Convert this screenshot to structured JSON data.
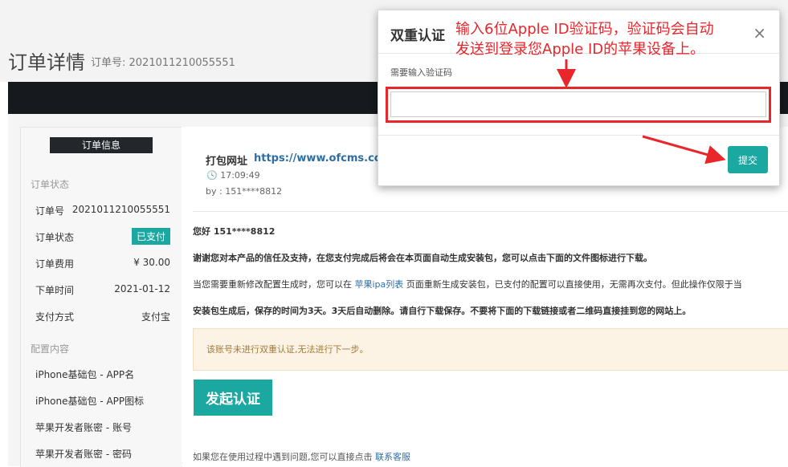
{
  "page": {
    "title": "订单详情",
    "order_no_label": "订单号: 2021011210055551"
  },
  "sidebar": {
    "title": "订单信息",
    "section_status": "订单状态",
    "rows": [
      {
        "key": "订单号",
        "value": "2021011210055551"
      },
      {
        "key": "订单状态",
        "value": "已支付"
      },
      {
        "key": "订单费用",
        "value": "¥ 30.00"
      },
      {
        "key": "下单时间",
        "value": "2021-01-12"
      },
      {
        "key": "支付方式",
        "value": "支付宝"
      }
    ],
    "section_config": "配置内容",
    "config_items": [
      "iPhone基础包 - APP名",
      "iPhone基础包 - APP图标",
      "苹果开发者账密 - 账号",
      "苹果开发者账密 - 密码"
    ]
  },
  "main": {
    "pack_url_label": "打包网址",
    "pack_url": "https://www.ofcms.co",
    "time": "17:09:49",
    "by": "by : 151****8812",
    "greeting": "您好 151****8812",
    "para1": "谢谢您对本产品的信任及支持，在您支付完成后将会在本页面自动生成安装包，您可以点击下面的文件图标进行下载。",
    "para2_a": "当您需要重新修改配置生成时，您可以在 ",
    "para2_link": "苹果ipa列表",
    "para2_b": " 页面重新生成安装包，已支付的配置可以直接使用，无需再次支付。但此操作仅限于当",
    "para3": "安装包生成后，保存的时间为3天。3天后自动删除。请自行下载保存。不要将下面的下载链接或者二维码直接挂到您的网站上。",
    "warning": "该账号未进行双重认证,无法进行下一步。",
    "start_button": "发起认证",
    "help_text": "如果您在使用过程中遇到问题,您可以直接点击 ",
    "help_link": "联系客服"
  },
  "modal": {
    "title": "双重认证",
    "close": "×",
    "input_label": "需要输入验证码",
    "input_value": "",
    "submit": "提交"
  },
  "annotation": {
    "line1": "输入6位Apple ID验证码，验证码会自动",
    "line2": "发送到登录您Apple ID的苹果设备上。",
    "color": "#e8262b"
  },
  "colors": {
    "accent": "#1aa8a0",
    "dark": "#16191d",
    "link": "#2d6da3",
    "warn_bg": "#fcf3e4"
  }
}
